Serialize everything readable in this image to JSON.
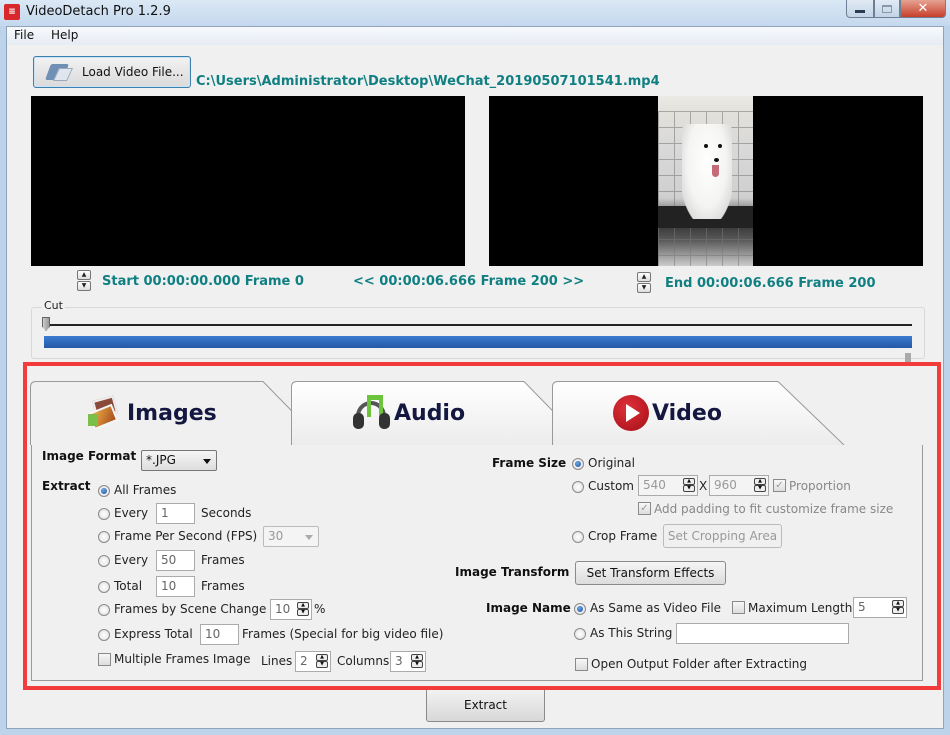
{
  "window": {
    "title": "VideoDetach Pro 1.2.9",
    "app_icon": "videodetach-logo-icon",
    "controls": {
      "minimize": "minimize-icon",
      "maximize": "maximize-icon",
      "close": "✕"
    }
  },
  "menu": [
    "File",
    "Help"
  ],
  "toolbar": {
    "load_label": "Load Video File...",
    "load_icon": "folder-open-icon",
    "file_path": "C:\\Users\\Administrator\\Desktop\\WeChat_20190507101541.mp4"
  },
  "timeline": {
    "start": "Start 00:00:00.000  Frame 0",
    "current": "<< 00:00:06.666  Frame 200 >>",
    "end": "End 00:00:06.666  Frame 200",
    "cut_label": "Cut",
    "cut_position_fraction": 0.0,
    "selected_range": [
      0.0,
      1.0
    ]
  },
  "tabs": [
    {
      "label": "Images",
      "icon": "images-icon",
      "active": true
    },
    {
      "label": "Audio",
      "icon": "headphones-icon",
      "active": false
    },
    {
      "label": "Video",
      "icon": "play-icon",
      "active": false
    }
  ],
  "images": {
    "format_label": "Image Format",
    "format_value": "*.JPG",
    "extract_label": "Extract",
    "options": {
      "all_frames": {
        "label": "All Frames",
        "selected": true
      },
      "every_seconds": {
        "label": "Every",
        "value": "1",
        "unit": "Seconds"
      },
      "fps": {
        "label": "Frame Per Second (FPS)",
        "value": "30"
      },
      "every_frames": {
        "label": "Every",
        "value": "50",
        "unit": "Frames"
      },
      "total": {
        "label": "Total",
        "value": "10",
        "unit": "Frames"
      },
      "scene_change": {
        "label": "Frames by Scene Change",
        "value": "10",
        "unit": "%"
      },
      "express_total": {
        "label": "Express Total",
        "value": "10",
        "unit": "Frames (Special for big video file)"
      }
    },
    "multiple_frames": {
      "label": "Multiple Frames Image",
      "checked": false,
      "lines_label": "Lines",
      "lines": "2",
      "columns_label": "Columns",
      "columns": "3"
    },
    "frame_size": {
      "label": "Frame Size",
      "original": "Original",
      "custom": "Custom",
      "width": "540",
      "x": "X",
      "height": "960",
      "proportion": "Proportion",
      "padding": "Add padding to fit customize frame size",
      "crop": "Crop Frame",
      "crop_button": "Set Cropping Area"
    },
    "transform": {
      "label": "Image Transform",
      "button": "Set Transform Effects"
    },
    "naming": {
      "label": "Image Name",
      "same_as_video": "As Same as Video File",
      "max_length_label": "Maximum Length",
      "max_length": "5",
      "as_string": "As This String",
      "string_value": ""
    },
    "open_folder": {
      "label": "Open Output Folder after Extracting",
      "checked": false
    }
  },
  "extract_button": "Extract",
  "colors": {
    "accent_teal": "#107f82",
    "highlight_red": "#f23b3b",
    "range_blue": "#2f6bbf",
    "tab_text": "#141840"
  }
}
